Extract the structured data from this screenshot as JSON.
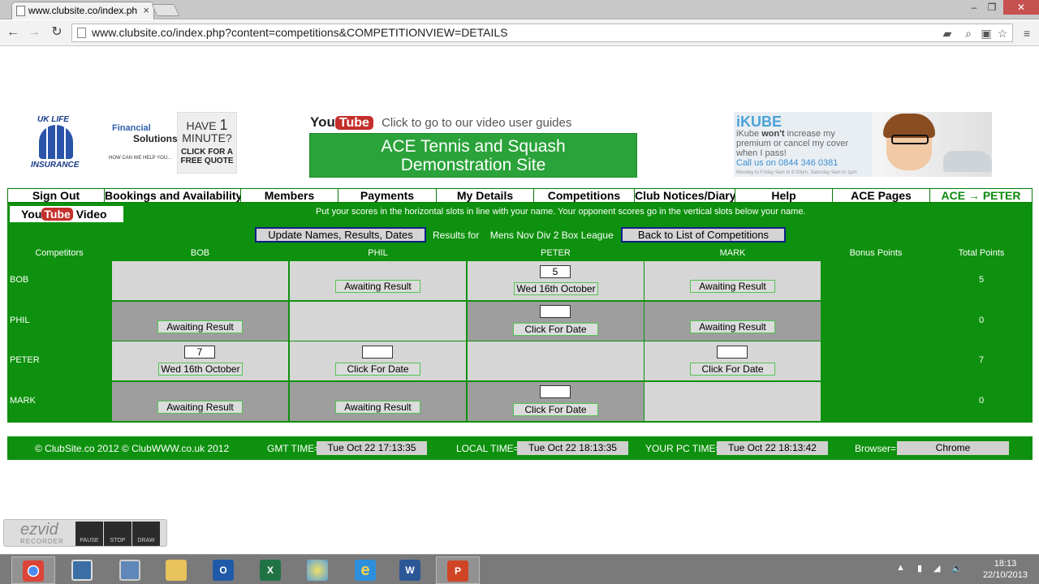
{
  "browser": {
    "tab_title": "www.clubsite.co/index.ph",
    "url": "www.clubsite.co/index.php?content=competitions&COMPETITIONVIEW=DETAILS",
    "win_min": "–",
    "win_max": "❐",
    "win_close": "✕"
  },
  "banner": {
    "uk_life": "UK LIFE",
    "insurance": "INSURANCE",
    "financial": "Financial",
    "solutions": "Solutions",
    "help_you": "HOW CAN WE HELP YOU...",
    "have": "HAVE",
    "one": "1",
    "minute": "MINUTE?",
    "click_quote": "CLICK FOR A FREE QUOTE",
    "yt_you": "You",
    "yt_tube": "Tube",
    "yt_text": "Click to go to our video user guides",
    "ace_line1": "ACE Tennis and Squash",
    "ace_line2": "Demonstration Site",
    "ikube_title": "iKUBE",
    "ikube_text1": "iKube",
    "ikube_wont": "won't",
    "ikube_text2": "increase my premium or cancel my cover when I pass!",
    "ikube_call": "Call us on 0844 346 0381",
    "ikube_small": "Monday to Friday 9am to 6:30pm, Saturday 9am to 1pm"
  },
  "menu": [
    "Sign Out",
    "Bookings and Availability",
    "Members",
    "Payments",
    "My Details",
    "Competitions",
    "Club Notices/Diary",
    "Help",
    "ACE Pages",
    "ACE → PETER"
  ],
  "main": {
    "yt_you": "You",
    "yt_tube": "Tube",
    "yt_video": "Video",
    "instructions": "Put your scores in the horizontal slots in line with your name.    Your opponent scores go in the vertical slots below your name.",
    "update_btn": "Update Names, Results, Dates",
    "results_for": "Results for",
    "league": "Mens Nov Div 2 Box League",
    "back_btn": "Back to List of Competitions",
    "col_competitors": "Competitors",
    "col_bonus": "Bonus Points",
    "col_total": "Total Points",
    "players": [
      "BOB",
      "PHIL",
      "PETER",
      "MARK"
    ],
    "totals": [
      "5",
      "0",
      "7",
      "0"
    ],
    "awaiting": "Awaiting Result",
    "click_date": "Click For Date",
    "wed_date": "Wed 16th October",
    "score_bob_peter": "5",
    "score_peter_bob": "7"
  },
  "footer": {
    "copyright": "© ClubSite.co 2012  © ClubWWW.co.uk 2012",
    "gmt_label": "GMT TIME=",
    "gmt_value": "Tue Oct 22 17:13:35",
    "local_label": "LOCAL TIME=",
    "local_value": "Tue Oct 22 18:13:35",
    "pc_label": "YOUR PC TIME=",
    "pc_value": "Tue Oct 22 18:13:42",
    "browser_label": "Browser=",
    "browser_value": "Chrome"
  },
  "ezvid": {
    "logo": "ezvid",
    "recorder": "RECORDER",
    "pause": "PAUSE",
    "stop": "STOP",
    "draw": "DRAW"
  },
  "taskbar": {
    "apps": [
      "chrome-icon",
      "remote-desktop-icon",
      "window-icon",
      "file-explorer-icon",
      "outlook-icon",
      "excel-icon",
      "paint-icon",
      "internet-explorer-icon",
      "word-icon",
      "powerpoint-icon"
    ],
    "time": "18:13",
    "date": "22/10/2013"
  },
  "colors": {
    "green": "#0e910e",
    "menu_green": "#0d8a0d",
    "youtube_red": "#c4302b",
    "button_border": "#0b1e8a"
  }
}
